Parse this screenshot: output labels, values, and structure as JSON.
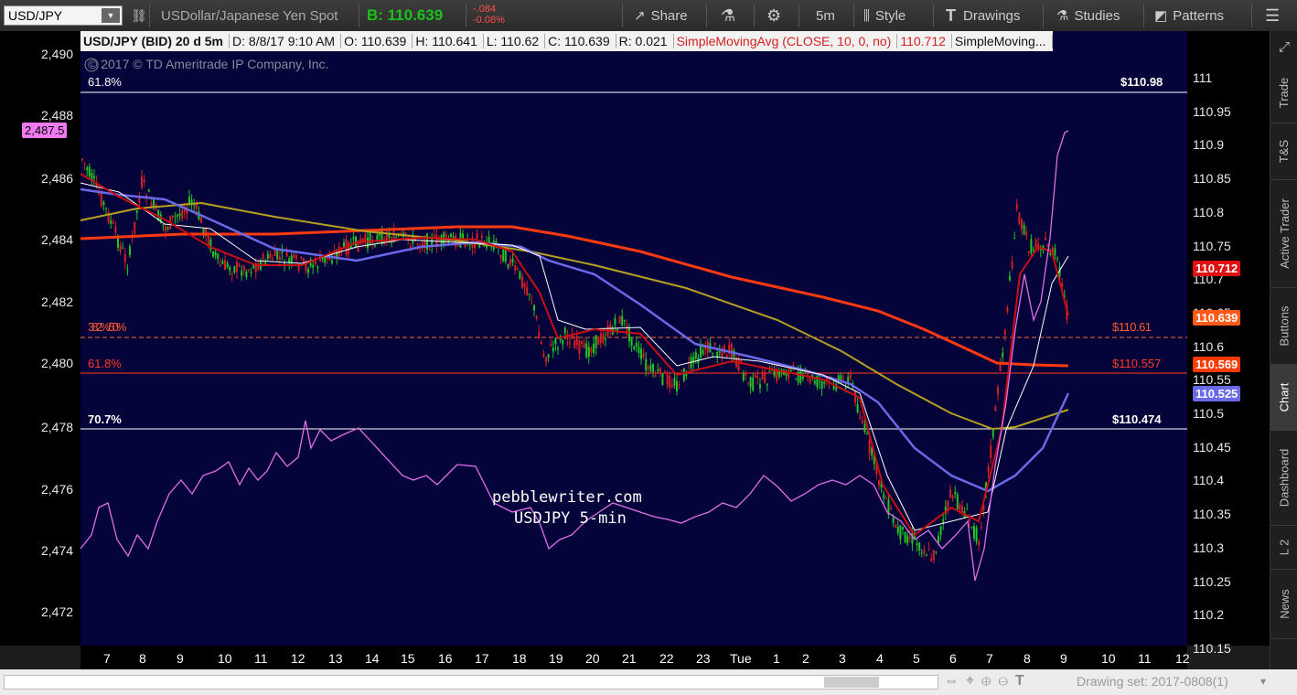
{
  "toolbar": {
    "symbol": "USD/JPY",
    "description": "USDollar/Japanese Yen Spot",
    "bid_label": "B: 110.639",
    "change": "-.084",
    "change_pct": "-0.08%",
    "share": "Share",
    "interval": "5m",
    "style": "Style",
    "drawings": "Drawings",
    "studies": "Studies",
    "patterns": "Patterns",
    "accent_green": "#19c319",
    "accent_red": "#ff4d4d"
  },
  "info": {
    "title": "USD/JPY (BID) 20 d 5m",
    "date": "D: 8/8/17 9:10 AM",
    "open": "O: 110.639",
    "high": "H: 110.641",
    "low": "L: 110.62",
    "close": "C: 110.639",
    "range": "R: 0.021",
    "sma": "SimpleMovingAvg (CLOSE, 10, 0, no)",
    "sma_value": "110.712",
    "sma2": "SimpleMoving..."
  },
  "chart": {
    "copyright": "© 2017 © TD Ameritrade IP Company, Inc.",
    "watermark_line1": "pebblewriter.com",
    "watermark_line2": "USDJPY 5-min",
    "left_axis": [
      "2,490",
      "2,488",
      "2,486",
      "2,484",
      "2,482",
      "2,480",
      "2,478",
      "2,476",
      "2,474",
      "2,472"
    ],
    "right_axis": [
      "111",
      "110.95",
      "110.9",
      "110.85",
      "110.8",
      "110.75",
      "110.7",
      "110.65",
      "110.6",
      "110.55",
      "110.5",
      "110.45",
      "110.4",
      "110.35",
      "110.3",
      "110.25",
      "110.2",
      "110.15"
    ],
    "x_axis": [
      "7",
      "8",
      "9",
      "10",
      "11",
      "12",
      "13",
      "14",
      "15",
      "16",
      "17",
      "18",
      "19",
      "20",
      "21",
      "22",
      "23",
      "Tue",
      "1",
      "2",
      "3",
      "4",
      "5",
      "6",
      "7",
      "8",
      "9",
      "10",
      "11",
      "12"
    ],
    "fib_levels": [
      {
        "label": "61.8%",
        "price": "$110.98"
      },
      {
        "label": "61.8%",
        "price": "$110.557"
      },
      {
        "label": "70.7%",
        "price": "$110.474"
      }
    ],
    "overlap_label": "38.2%/50%",
    "overlap_price": "$110.61",
    "left_tag": "2,487.5",
    "tags": [
      {
        "text": "110.712",
        "color": "#e01010"
      },
      {
        "text": "110.639",
        "color": "#ff5a1a"
      },
      {
        "text": "110.569",
        "color": "#ff3a00"
      },
      {
        "text": "110.525",
        "color": "#6a6ae8"
      }
    ]
  },
  "right_tabs": [
    "Trade",
    "T&S",
    "Active Trader",
    "Buttons",
    "Chart",
    "Dashboard",
    "L 2",
    "News"
  ],
  "bottom": {
    "drawing_set": "Drawing set: 2017-0808(1)"
  }
}
